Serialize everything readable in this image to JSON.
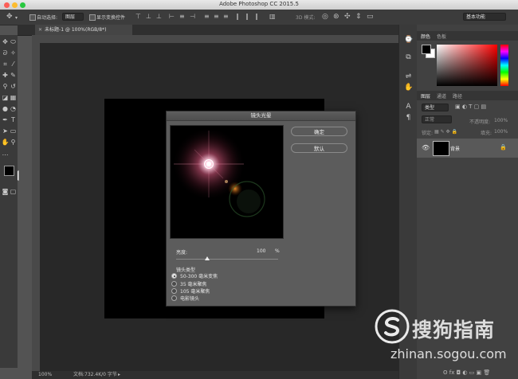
{
  "app": {
    "title": "Adobe Photoshop CC 2015.5"
  },
  "options_bar": {
    "auto_select_label": "自动选择:",
    "auto_select_value": "图层",
    "show_transform_label": "显示变换控件",
    "mode_3d_label": "3D 模式:",
    "workspace_value": "基本功能"
  },
  "document": {
    "tab_label": "未标题-1 @ 100%(RGB/8*)"
  },
  "status": {
    "zoom": "100%",
    "doc_info": "文档:732.4K/0 字节"
  },
  "panels": {
    "color_tabs": [
      "颜色",
      "色板"
    ],
    "layers_tabs": [
      "图层",
      "通道",
      "路径"
    ],
    "kind_filter": "类型",
    "blend_mode": "正常",
    "opacity_label": "不透明度:",
    "opacity_value": "100%",
    "lock_label": "锁定:",
    "fill_label": "填充:",
    "fill_value": "100%",
    "layer_name": "背景"
  },
  "dialog": {
    "title": "镜头光晕",
    "ok_label": "确定",
    "reset_label": "默认",
    "brightness_label": "亮度:",
    "brightness_value": "100",
    "brightness_unit": "%",
    "brightness_level": 1.0,
    "lens_type_label": "镜头类型",
    "lens_options": [
      {
        "label": "50-300 毫米变焦",
        "selected": true
      },
      {
        "label": "35 毫米聚焦",
        "selected": false
      },
      {
        "label": "105 毫米聚焦",
        "selected": false
      },
      {
        "label": "电影镜头",
        "selected": false
      }
    ]
  },
  "watermark": {
    "brand": "搜狗指南",
    "url": "zhinan.sogou.com"
  },
  "colors": {
    "foreground": "#000000",
    "background": "#ffffff",
    "canvas": "#000000"
  }
}
